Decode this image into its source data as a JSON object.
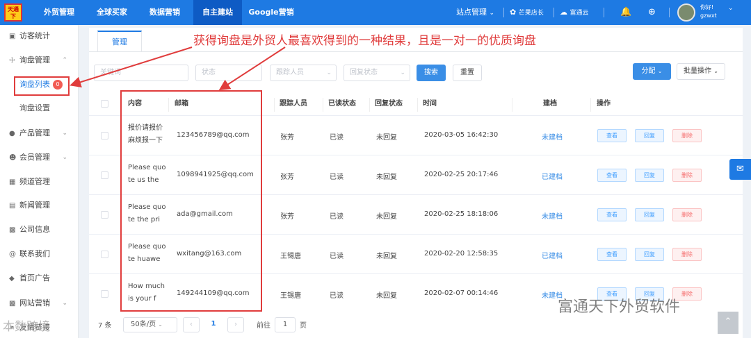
{
  "logo_text": "天通下",
  "topnav": [
    "外贸管理",
    "全球买家",
    "数据营销",
    "自主建站",
    "Google营销"
  ],
  "topnav_active": "自主建站",
  "top_right": {
    "site_mgmt": "站点管理",
    "store": "芒果店长",
    "cloud": "富通云",
    "greeting": "你好!",
    "username": "gzwxt"
  },
  "sidebar": {
    "items": [
      {
        "icon": "monitor-icon",
        "label": "访客统计"
      },
      {
        "icon": "cart-icon",
        "label": "询盘管理",
        "expanded": true
      },
      {
        "icon": "product-icon",
        "label": "产品管理"
      },
      {
        "icon": "member-icon",
        "label": "会员管理"
      },
      {
        "icon": "channel-icon",
        "label": "频道管理"
      },
      {
        "icon": "news-icon",
        "label": "新闻管理"
      },
      {
        "icon": "company-icon",
        "label": "公司信息"
      },
      {
        "icon": "at-icon",
        "label": "联系我们"
      },
      {
        "icon": "ad-icon",
        "label": "首页广告"
      },
      {
        "icon": "chart-icon",
        "label": "网站营销"
      },
      {
        "icon": "link-icon",
        "label": "友情链接"
      }
    ],
    "sub_list": "询盘列表",
    "sub_list_badge": "0",
    "sub_settings": "询盘设置"
  },
  "tab_label": "管理",
  "filters": {
    "keyword": "关键词",
    "status": "状态",
    "follower": "跟踪人员",
    "reply_status": "回复状态",
    "search": "搜索",
    "reset": "重置",
    "assign": "分配",
    "batch": "批量操作"
  },
  "columns": [
    "内容",
    "邮箱",
    "跟踪人员",
    "已读状态",
    "回复状态",
    "时间",
    "建档",
    "操作"
  ],
  "rows": [
    {
      "content": "报价请报价麻烦报一下",
      "email": "123456789@qq.com",
      "follower": "张芳",
      "read": "已读",
      "reply": "未回复",
      "time": "2020-03-05 16:42:30",
      "archive": "未建档"
    },
    {
      "content": "Please quote us the",
      "email": "1098941925@qq.com",
      "follower": "张芳",
      "read": "已读",
      "reply": "未回复",
      "time": "2020-02-25 20:17:46",
      "archive": "已建档"
    },
    {
      "content": "Please quote the pri",
      "email": "ada@gmail.com",
      "follower": "张芳",
      "read": "已读",
      "reply": "未回复",
      "time": "2020-02-25 18:18:06",
      "archive": "未建档"
    },
    {
      "content": "Please quote huawe",
      "email": "wxitang@163.com",
      "follower": "王锡唐",
      "read": "已读",
      "reply": "未回复",
      "time": "2020-02-20 12:58:35",
      "archive": "已建档"
    },
    {
      "content": "How much is your f",
      "email": "149244109@qq.com",
      "follower": "王锡唐",
      "read": "已读",
      "reply": "未回复",
      "time": "2020-02-07 00:14:46",
      "archive": "未建档"
    }
  ],
  "ops": {
    "view": "查看",
    "reply": "回复",
    "delete": "删除"
  },
  "pager": {
    "total": "7 条",
    "page_size": "50条/页",
    "current": "1",
    "goto": "前往",
    "goto_value": "1",
    "page_unit": "页"
  },
  "annotation": "获得询盘是外贸人最喜欢得到的一种结果，且是一对一的优质询盘",
  "watermark": "富通天下外贸软件",
  "watermark_left": "本数跨境",
  "colors": {
    "primary": "#1e7ae3",
    "annotation": "#e03c3c",
    "badge": "#f25c54"
  }
}
